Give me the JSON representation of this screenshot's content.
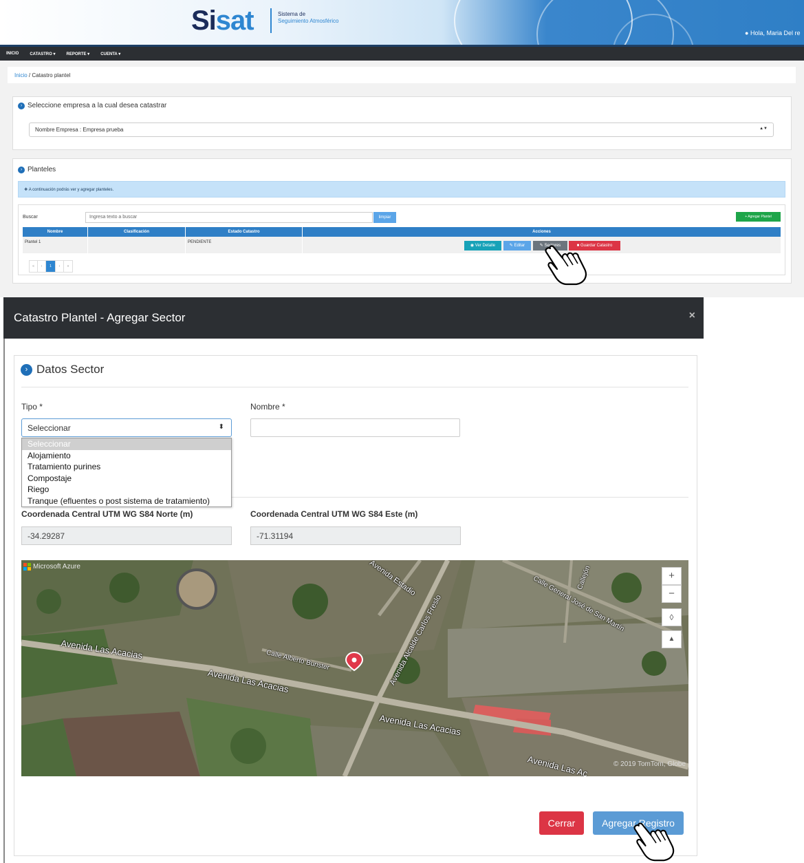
{
  "header": {
    "logo_part1": "Si",
    "logo_part2": "sat",
    "logo_sub1": "Sistema de",
    "logo_sub2": "Seguimiento Atmosférico",
    "greeting": "Hola, Maria Del re"
  },
  "nav": {
    "items": [
      "INICIO",
      "CATASTRO",
      "REPORTE",
      "CUENTA"
    ]
  },
  "breadcrumb": {
    "home": "Inicio",
    "sep": "/",
    "current": "Catastro plantel"
  },
  "empresa_panel": {
    "title": "Seleccione empresa a la cual desea catastrar",
    "select_value": "Nombre Empresa : Empresa prueba"
  },
  "planteles_panel": {
    "title": "Planteles",
    "info": "A continuación podrás ver y agregar planteles.",
    "search_label": "Buscar",
    "search_placeholder": "Ingresa texto a buscar",
    "clear_button": "limpiar",
    "add_button": "Agregar Plantel",
    "columns": [
      "Nombre",
      "Clasificación",
      "Estado Catastro",
      "Acciones"
    ],
    "rows": [
      {
        "nombre": "Plantel 1",
        "clasificacion": "",
        "estado": "PENDIENTE"
      }
    ],
    "actions": {
      "ver": "Ver Detalle",
      "editar": "Editar",
      "sectores": "Sectores",
      "guardar": "Guardar Catastro"
    },
    "pager": [
      "«",
      "‹",
      "1",
      "›",
      "»"
    ]
  },
  "modal": {
    "title": "Catastro Plantel - Agregar Sector",
    "close": "×",
    "section_title": "Datos Sector",
    "tipo_label": "Tipo *",
    "tipo_value": "Seleccionar",
    "tipo_options": [
      "Seleccionar",
      "Alojamiento",
      "Tratamiento purines",
      "Compostaje",
      "Riego",
      "Tranque (efluentes o post sistema de tratamiento)"
    ],
    "nombre_label": "Nombre *",
    "norte_label": "Coordenada Central UTM WG S84 Norte (m)",
    "norte_value": "-34.29287",
    "este_label": "Coordenada Central UTM WG S84 Este (m)",
    "este_value": "-71.31194",
    "map": {
      "provider": "Microsoft Azure",
      "copyright": "© 2019 TomTom, Globe",
      "roads": [
        "Avenida Las Acacias",
        "Avenida Las Acacias",
        "Avenida Las Acacias",
        "Avenida Las Ac",
        "Avenida Estadio",
        "Avenida Alcalde Carlos Freslo",
        "Calle Alberto Bunster",
        "Calle General José de San Martín",
        "Callejón"
      ],
      "controls": [
        "+",
        "−",
        "◊",
        "▲"
      ]
    },
    "cerrar_button": "Cerrar",
    "agregar_button": "Agregar Registro"
  },
  "colors": {
    "primary": "#2f7fc6",
    "danger": "#dc3545",
    "success": "#1ea54a",
    "dark": "#2c2f33"
  }
}
